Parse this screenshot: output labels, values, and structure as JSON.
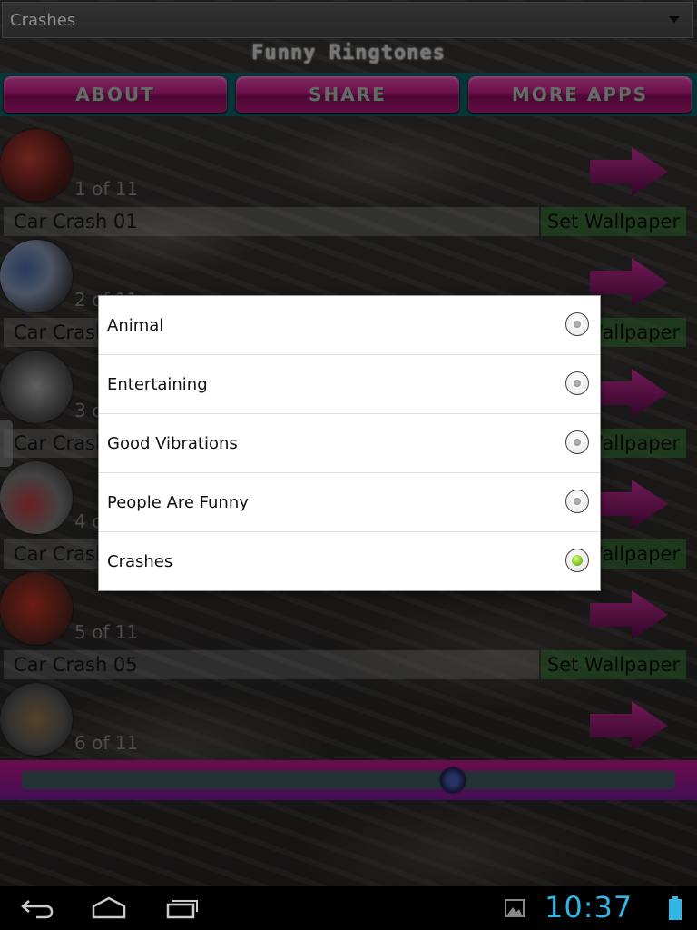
{
  "category_spinner": {
    "selected": "Crashes"
  },
  "app_title": "Funny Ringtones",
  "nav": {
    "about": "ABOUT",
    "share": "SHARE",
    "more_apps": "MORE APPS"
  },
  "items": [
    {
      "counter": "1 of 11",
      "name": "Car Crash 01",
      "wallpaper_label": "Set Wallpaper"
    },
    {
      "counter": "2 of 11",
      "name": "Car Crash 02",
      "wallpaper_label": "Set Wallpaper"
    },
    {
      "counter": "3 of 11",
      "name": "Car Crash 03",
      "wallpaper_label": "Set Wallpaper"
    },
    {
      "counter": "4 of 11",
      "name": "Car Crash 04",
      "wallpaper_label": "Set Wallpaper"
    },
    {
      "counter": "5 of 11",
      "name": "Car Crash 05",
      "wallpaper_label": "Set Wallpaper"
    },
    {
      "counter": "6 of 11"
    }
  ],
  "seek": {
    "progress": 0.66
  },
  "dialog": {
    "options": [
      {
        "label": "Animal",
        "selected": false
      },
      {
        "label": "Entertaining",
        "selected": false
      },
      {
        "label": "Good Vibrations",
        "selected": false
      },
      {
        "label": "People Are Funny",
        "selected": false
      },
      {
        "label": "Crashes",
        "selected": true
      }
    ]
  },
  "system_bar": {
    "time": "10:37",
    "icons": [
      "back-icon",
      "home-icon",
      "recent-apps-icon",
      "gallery-icon",
      "battery-icon"
    ]
  },
  "colors": {
    "nav_button": "#c41c88",
    "arrow": "#8d1470",
    "clock": "#33b5e5",
    "radio_selected": "#7cc41e"
  }
}
